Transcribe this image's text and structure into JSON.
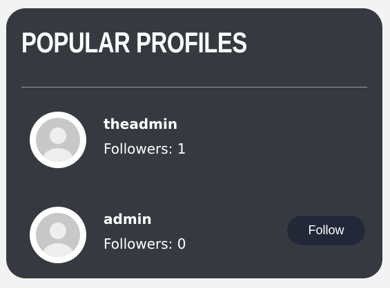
{
  "title": "POPULAR PROFILES",
  "profiles": [
    {
      "username": "theadmin",
      "followers_label": "Followers: 1",
      "follow_button": null
    },
    {
      "username": "admin",
      "followers_label": "Followers: 0",
      "follow_button": "Follow"
    }
  ],
  "colors": {
    "page_background": "#f3f3f4",
    "card_background": "#363a40",
    "text": "#ffffff",
    "button_background": "#232838",
    "avatar_placeholder": "#c8c8c8"
  },
  "icons": {
    "avatar": "default-user-avatar-icon"
  }
}
